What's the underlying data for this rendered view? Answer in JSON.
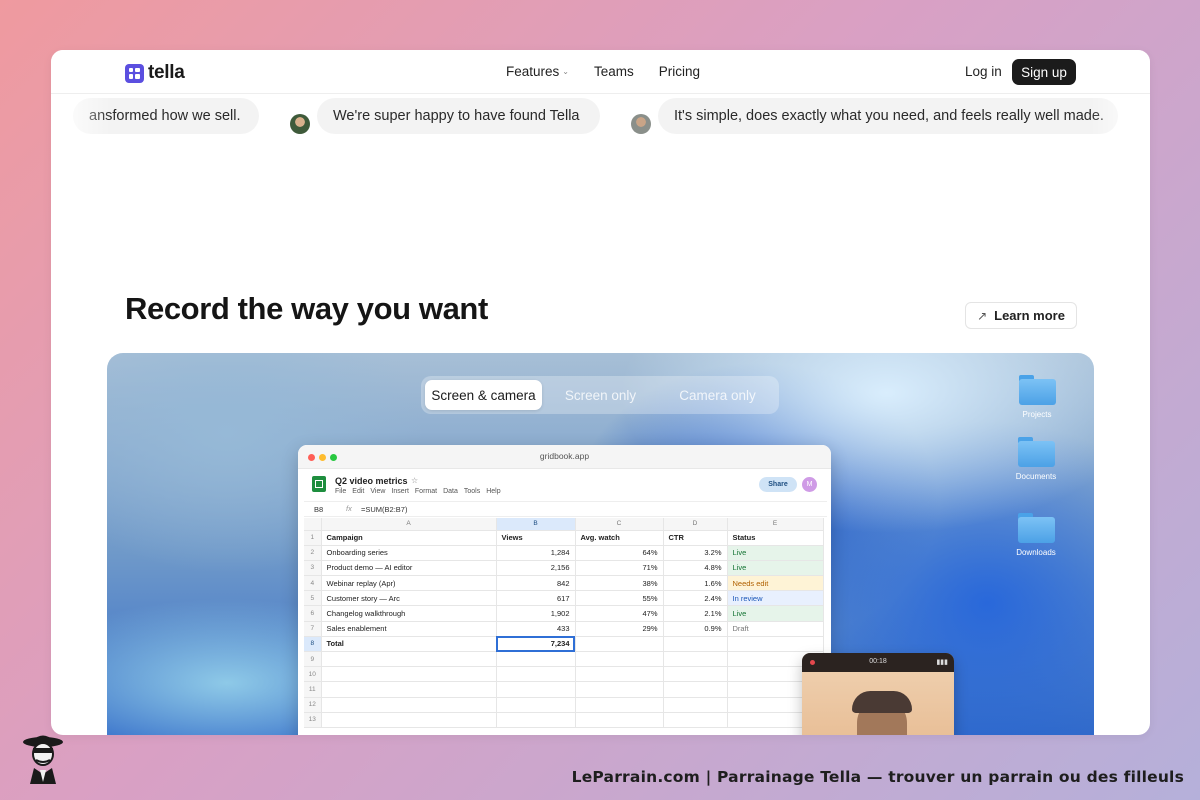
{
  "brand": {
    "name": "tella",
    "accent": "#5b4fe0"
  },
  "nav": {
    "links": [
      "Features",
      "Teams",
      "Pricing"
    ],
    "login": "Log in",
    "signup": "Sign up"
  },
  "testimonials": [
    "ansformed how we sell.",
    "We're super happy to have found Tella",
    "It's simple, does exactly what you need, and feels really well made."
  ],
  "section": {
    "headline": "Record the way you want",
    "learn_more": "Learn more"
  },
  "modes": [
    "Screen & camera",
    "Screen only",
    "Camera only"
  ],
  "desktop_folders": [
    "Projects",
    "Documents",
    "Downloads"
  ],
  "browser": {
    "url": "gridbook.app"
  },
  "sheet": {
    "title": "Q2 video metrics",
    "menu": [
      "File",
      "Edit",
      "View",
      "Insert",
      "Format",
      "Data",
      "Tools",
      "Help"
    ],
    "share": "Share",
    "user_initial": "M",
    "cell_ref": "B8",
    "fx": "fx",
    "formula": "=SUM(B2:B7)",
    "columns": [
      "A",
      "B",
      "C",
      "D",
      "E"
    ],
    "rows": [
      {
        "n": "1",
        "cells": [
          "Campaign",
          "Views",
          "Avg. watch",
          "CTR",
          "Status"
        ]
      },
      {
        "n": "2",
        "cells": [
          "Onboarding series",
          "1,284",
          "64%",
          "3.2%",
          "Live"
        ]
      },
      {
        "n": "3",
        "cells": [
          "Product demo — AI editor",
          "2,156",
          "71%",
          "4.8%",
          "Live"
        ]
      },
      {
        "n": "4",
        "cells": [
          "Webinar replay (Apr)",
          "842",
          "38%",
          "1.6%",
          "Needs edit"
        ]
      },
      {
        "n": "5",
        "cells": [
          "Customer story — Arc",
          "617",
          "55%",
          "2.4%",
          "In review"
        ]
      },
      {
        "n": "6",
        "cells": [
          "Changelog walkthrough",
          "1,902",
          "47%",
          "2.1%",
          "Live"
        ]
      },
      {
        "n": "7",
        "cells": [
          "Sales enablement",
          "433",
          "29%",
          "0.9%",
          "Draft"
        ]
      },
      {
        "n": "8",
        "cells": [
          "Total",
          "7,234",
          "",
          "",
          ""
        ]
      },
      {
        "n": "9",
        "cells": [
          "",
          "",
          "",
          "",
          ""
        ]
      },
      {
        "n": "10",
        "cells": [
          "",
          "",
          "",
          "",
          ""
        ]
      },
      {
        "n": "11",
        "cells": [
          "",
          "",
          "",
          "",
          ""
        ]
      },
      {
        "n": "12",
        "cells": [
          "",
          "",
          "",
          "",
          ""
        ]
      },
      {
        "n": "13",
        "cells": [
          "",
          "",
          "",
          "",
          ""
        ]
      }
    ]
  },
  "camera": {
    "timer": "00:18",
    "signal": "▮▮▮"
  },
  "footer": {
    "caption": "LeParrain.com | Parrainage Tella — trouver un parrain ou des filleuls"
  }
}
